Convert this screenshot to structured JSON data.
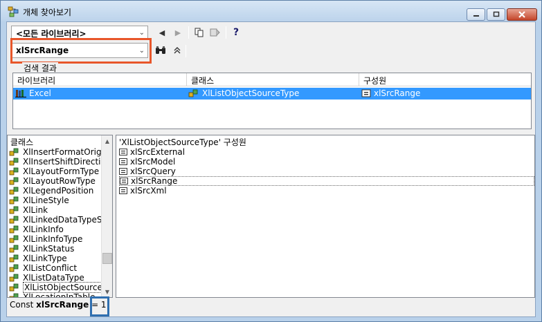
{
  "window": {
    "title": "개체 찾아보기",
    "accent": "#3399ff",
    "highlight_orange": "#e8562a",
    "highlight_blue": "#2f6fb0"
  },
  "toolbar": {
    "library_combo": "<모든 라이브러리>",
    "search_combo": "xlSrcRange",
    "icons": [
      "back-icon",
      "forward-icon",
      "copy-icon",
      "view-definition-icon",
      "help-icon",
      "search-binoculars-icon",
      "collapse-icon"
    ],
    "help_glyph": "?"
  },
  "results": {
    "label": "검색 결과",
    "columns": [
      "라이브러리",
      "클래스",
      "구성원"
    ],
    "row": {
      "library": "Excel",
      "class": "XlListObjectSourceType",
      "member": "xlSrcRange"
    }
  },
  "classes": {
    "header": "클래스",
    "items": [
      "XlInsertFormatOrigin",
      "XlInsertShiftDirection",
      "XlLayoutFormType",
      "XlLayoutRowType",
      "XlLegendPosition",
      "XlLineStyle",
      "XlLink",
      "XlLinkedDataTypeState",
      "XlLinkInfo",
      "XlLinkInfoType",
      "XlLinkStatus",
      "XlLinkType",
      "XlListConflict",
      "XlListDataType",
      "XlListObjectSourceType",
      "XlLocationInTable"
    ],
    "selected_index": 14
  },
  "members": {
    "header": "'XlListObjectSourceType' 구성원",
    "items": [
      "xlSrcExternal",
      "xlSrcModel",
      "xlSrcQuery",
      "xlSrcRange",
      "xlSrcXml"
    ],
    "selected_index": 3
  },
  "status": {
    "prefix": "Const ",
    "name": "xlSrcRange",
    "suffix": " = 1"
  }
}
